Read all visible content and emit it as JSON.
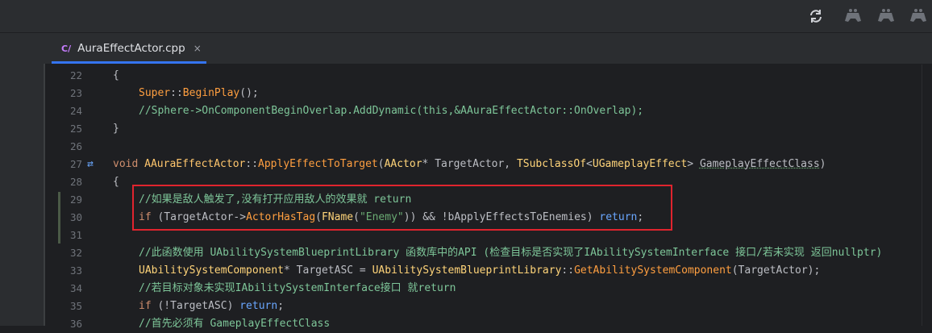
{
  "tab": {
    "file_icon": "C/",
    "filename": "AuraEffectActor.cpp",
    "close": "×"
  },
  "topbar": {
    "icons": [
      "sync-icon",
      "gamepad-icon",
      "gamepad-icon",
      "gamepad-icon"
    ]
  },
  "lines": [
    {
      "n": "22"
    },
    {
      "n": "23"
    },
    {
      "n": "24"
    },
    {
      "n": "25"
    },
    {
      "n": "26"
    },
    {
      "n": "27"
    },
    {
      "n": "28"
    },
    {
      "n": "29"
    },
    {
      "n": "30"
    },
    {
      "n": "31"
    },
    {
      "n": "32"
    },
    {
      "n": "33"
    },
    {
      "n": "34"
    },
    {
      "n": "35"
    },
    {
      "n": "36"
    }
  ],
  "code": {
    "l22": "{",
    "l23_super": "Super",
    "l23_sep": "::",
    "l23_fn": "BeginPlay",
    "l23_tail": "();",
    "l24": "//Sphere->OnComponentBeginOverlap.AddDynamic(this,&AAuraEffectActor::OnOverlap);",
    "l25": "}",
    "l27_void": "void",
    "l27_class": "AAuraEffectActor",
    "l27_sep": "::",
    "l27_fn": "ApplyEffectToTarget",
    "l27_p1type": "AActor",
    "l27_p1": "* TargetActor, ",
    "l27_p2type": "TSubclassOf",
    "l27_lt": "<",
    "l27_p2inner": "UGameplayEffect",
    "l27_gt": "> ",
    "l27_p2name": "GameplayEffectClass",
    "l27_close": ")",
    "l28": "{",
    "l29": "//如果是敌人触发了,没有打开应用敌人的效果就 return",
    "l30_if": "if",
    "l30_a": " (TargetActor->",
    "l30_fn": "ActorHasTag",
    "l30_b": "(",
    "l30_fname": "FName",
    "l30_c": "(",
    "l30_str": "\"Enemy\"",
    "l30_d": ")) && !bApplyEffectsToEnemies) ",
    "l30_ret": "return",
    "l30_e": ";",
    "l32": "//此函数使用 UAbilitySystemBlueprintLibrary 函数库中的API (检查目标是否实现了IAbilitySystemInterface 接口/若未实现 返回nullptr)",
    "l33_type": "UAbilitySystemComponent",
    "l33_a": "* TargetASC = ",
    "l33_lib": "UAbilitySystemBlueprintLibrary",
    "l33_sep": "::",
    "l33_fn": "GetAbilitySystemComponent",
    "l33_b": "(TargetActor);",
    "l34": "//若目标对象未实现IAbilitySystemInterface接口 就return",
    "l35_if": "if",
    "l35_a": " (!TargetASC) ",
    "l35_ret": "return",
    "l35_b": ";",
    "l36": "//首先必须有 GameplayEffectClass"
  },
  "colors": {
    "highlight_box": "#e0242e",
    "accent_tab": "#3574f0"
  }
}
